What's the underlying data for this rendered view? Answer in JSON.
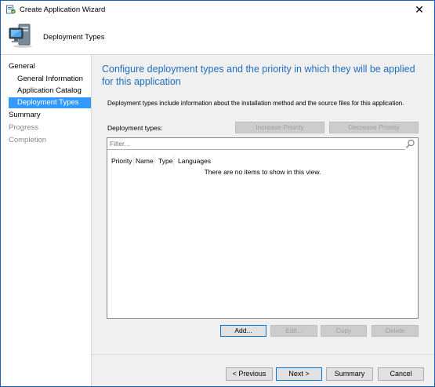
{
  "window": {
    "title": "Create Application Wizard",
    "close_glyph": "✕"
  },
  "header": {
    "title": "Deployment Types",
    "icon": "computer-monitor-icon"
  },
  "sidebar": {
    "items": [
      {
        "label": "General",
        "level": "category",
        "state": "normal"
      },
      {
        "label": "General Information",
        "level": "sub",
        "state": "normal"
      },
      {
        "label": "Application Catalog",
        "level": "sub",
        "state": "normal"
      },
      {
        "label": "Deployment Types",
        "level": "sub",
        "state": "selected"
      },
      {
        "label": "Summary",
        "level": "category",
        "state": "normal"
      },
      {
        "label": "Progress",
        "level": "category",
        "state": "disabled"
      },
      {
        "label": "Completion",
        "level": "category",
        "state": "disabled"
      }
    ]
  },
  "main": {
    "heading": "Configure deployment types and the priority in which they will be applied for this application",
    "description": "Deployment types include information about the installation method and the source files for this application.",
    "deployment_types_label": "Deployment types:",
    "increase_priority_label": "Increase Priority",
    "decrease_priority_label": "Decrease Priority",
    "filter_placeholder": "Filter...",
    "columns": [
      "Priority",
      "Name",
      "Type",
      "Languages"
    ],
    "empty_message": "There are no items to show in this view.",
    "actions": {
      "add": "Add...",
      "edit": "Edit...",
      "copy": "Copy",
      "delete": "Delete"
    }
  },
  "footer": {
    "previous": "< Previous",
    "next": "Next >",
    "summary": "Summary",
    "cancel": "Cancel"
  },
  "colors": {
    "accent_heading": "#1e6fbf",
    "selection": "#3399ff",
    "panel_bg": "#f0f0f0"
  }
}
